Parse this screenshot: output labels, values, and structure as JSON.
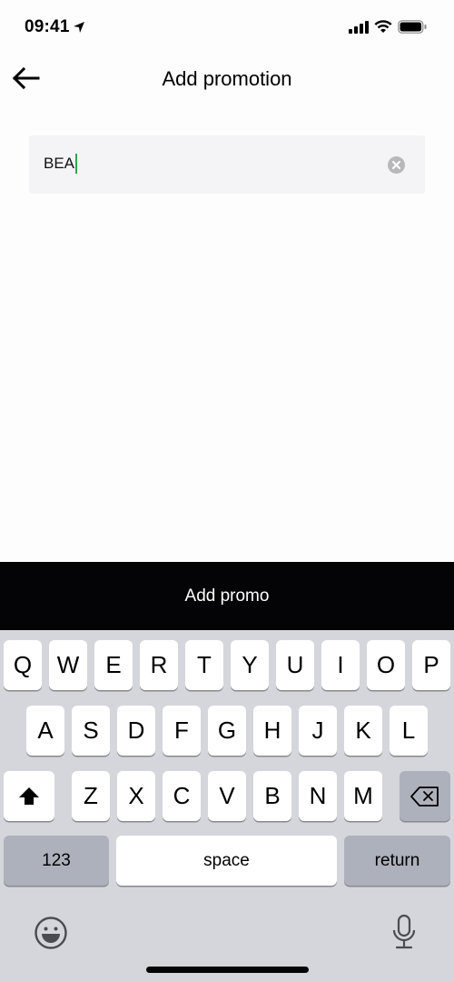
{
  "status_bar": {
    "time": "09:41",
    "icons": [
      "location-arrow-icon",
      "cellular-signal-icon",
      "wifi-icon",
      "battery-icon"
    ]
  },
  "nav": {
    "title": "Add promotion",
    "back_icon": "arrow-left-icon"
  },
  "promo_field": {
    "value": "BEA",
    "clear_icon": "clear-circle-icon",
    "caret_color": "#2aa84a"
  },
  "primary_button": {
    "label": "Add promo",
    "background": "#040305"
  },
  "keyboard": {
    "row1": [
      "Q",
      "W",
      "E",
      "R",
      "T",
      "Y",
      "U",
      "I",
      "O",
      "P"
    ],
    "row2": [
      "A",
      "S",
      "D",
      "F",
      "G",
      "H",
      "J",
      "K",
      "L"
    ],
    "row3": [
      "Z",
      "X",
      "C",
      "V",
      "B",
      "N",
      "M"
    ],
    "shift_icon": "shift-icon",
    "delete_icon": "delete-backspace-icon",
    "numbers_label": "123",
    "space_label": "space",
    "return_label": "return",
    "emoji_icon": "emoji-icon",
    "mic_icon": "microphone-icon"
  }
}
